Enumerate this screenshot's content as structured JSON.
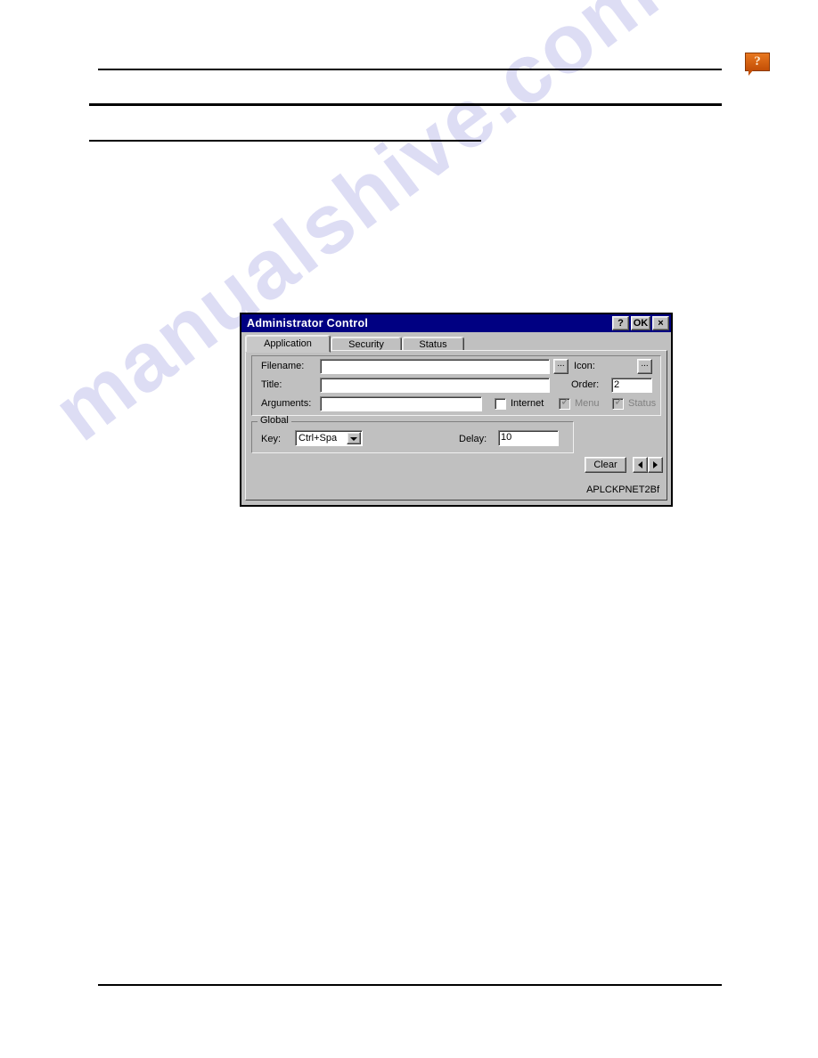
{
  "page": {
    "watermark_text": "manualshive.com",
    "help_icon": "help-bubble-icon",
    "help_glyph": "?"
  },
  "dialog": {
    "title": "Administrator Control",
    "titlebar_color": "#000082",
    "face_color": "#c0c0c0",
    "titlebar_buttons": [
      {
        "name": "help-button",
        "label": "?"
      },
      {
        "name": "ok-button",
        "label": "OK"
      },
      {
        "name": "close-button",
        "label": "×"
      }
    ],
    "tabs": [
      {
        "label": "Application",
        "active": true
      },
      {
        "label": "Security",
        "active": false
      },
      {
        "label": "Status",
        "active": false
      }
    ],
    "application_tab": {
      "fields": {
        "filename": {
          "label": "Filename:",
          "value": "",
          "browse_label": "..."
        },
        "title": {
          "label": "Title:",
          "value": ""
        },
        "arguments": {
          "label": "Arguments:",
          "value": ""
        },
        "icon": {
          "label": "Icon:",
          "browse_label": "..."
        },
        "order": {
          "label": "Order:",
          "value": "2"
        }
      },
      "checkboxes": [
        {
          "label": "Internet",
          "checked": false,
          "disabled": false
        },
        {
          "label": "Menu",
          "checked": true,
          "disabled": true
        },
        {
          "label": "Status",
          "checked": true,
          "disabled": true
        }
      ],
      "global_group": {
        "legend": "Global",
        "key_label": "Key:",
        "key_value": "Ctrl+Spa",
        "delay_label": "Delay:",
        "delay_value": "10"
      },
      "clear_label": "Clear",
      "spinner": {
        "prev": "◄",
        "next": "►"
      },
      "build_string": "APLCKPNET2Bf"
    }
  }
}
